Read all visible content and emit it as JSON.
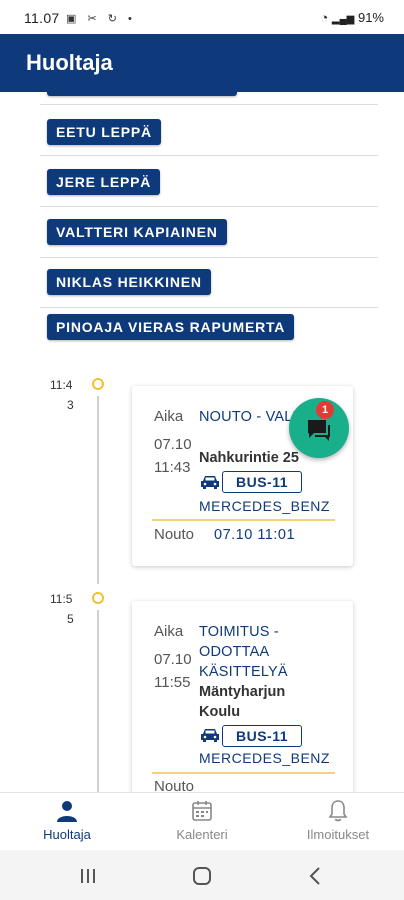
{
  "statusbar": {
    "time": "11.07",
    "battery": "91%"
  },
  "appbar": {
    "title": "Huoltaja"
  },
  "names": [
    "EETU LEPPÄ",
    "JERE LEPPÄ",
    "VALTTERI KAPIAINEN",
    "NIKLAS HEIKKINEN",
    "PINOAJA VIERAS RAPUMERTA"
  ],
  "timeline": [
    {
      "time_a": "11:4",
      "time_b": "3",
      "label": "Aika",
      "date": "07.10",
      "time": "11:43",
      "status": "NOUTO - VALMIS",
      "address": "Nahkurintie 25",
      "bus": "BUS-11",
      "vehicle": "MERCEDES_BENZ",
      "footer_label": "Nouto",
      "footer_value": "07.10 11:01"
    },
    {
      "time_a": "11:5",
      "time_b": "5",
      "label": "Aika",
      "date": "07.10",
      "time": "11:55",
      "status": "TOIMITUS - ODOTTAA KÄSITTELYÄ",
      "address": "Mäntyharjun Koulu",
      "bus": "BUS-11",
      "vehicle": "MERCEDES_BENZ",
      "footer_label": "Nouto"
    }
  ],
  "chat": {
    "badge": "1"
  },
  "nav": [
    {
      "label": "Huoltaja",
      "icon": "person-icon",
      "active": true
    },
    {
      "label": "Kalenteri",
      "icon": "calendar-icon",
      "active": false
    },
    {
      "label": "Ilmoitukset",
      "icon": "bell-icon",
      "active": false
    }
  ],
  "colors": {
    "primary": "#0e3a7c",
    "accent": "#1aaf8b",
    "badge": "#e53935",
    "timeline_dot": "#f0c230"
  }
}
